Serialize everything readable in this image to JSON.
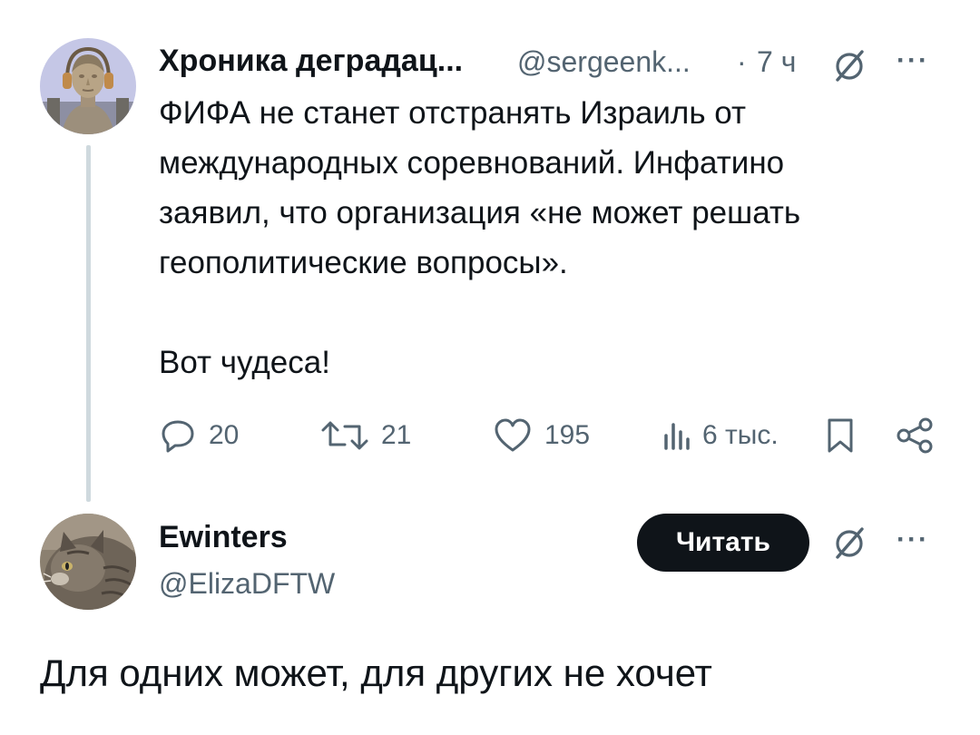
{
  "tweet": {
    "author_name": "Хроника деградац...",
    "handle": "@sergeenk...",
    "separator": "·",
    "time": "7 ч",
    "more_label": "···",
    "body": "ФИФА не станет отстранять Израиль от\nмеждународных соревнований. Инфатино\nзаявил, что организация «не может решать\nгеополитические вопросы».\n\nВот чудеса!",
    "actions": {
      "replies": "20",
      "retweets": "21",
      "likes": "195",
      "views": "6 тыс."
    }
  },
  "reply": {
    "author_name": "Ewinters",
    "handle": "@ElizaDFTW",
    "follow_label": "Читать",
    "more_label": "···",
    "text": "Для одних может, для других не хочет"
  },
  "icons": {
    "grok": "grok-icon",
    "reply": "reply-icon",
    "retweet": "retweet-icon",
    "like": "heart-icon",
    "views": "views-icon",
    "bookmark": "bookmark-icon",
    "share": "share-icon"
  },
  "colors": {
    "text": "#0f1419",
    "muted": "#536471",
    "thread_line": "#cfd9de",
    "button_bg": "#0f1419",
    "button_text": "#ffffff"
  }
}
